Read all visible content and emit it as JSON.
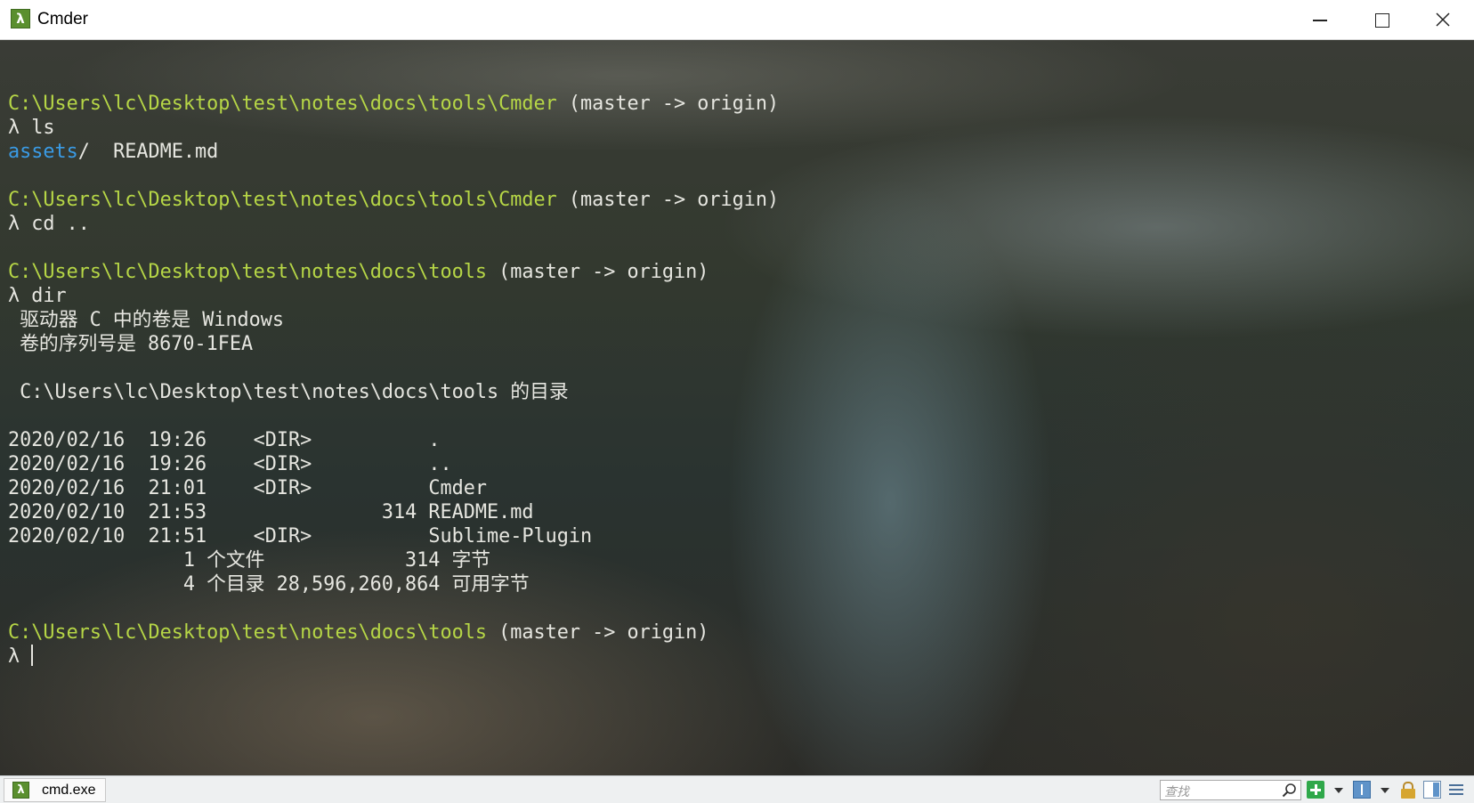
{
  "window": {
    "title": "Cmder",
    "icon_glyph": "λ"
  },
  "terminal": {
    "colors": {
      "path": "#b6d646",
      "text": "#e6e6e0",
      "dir": "#3a9be6"
    },
    "lines": [
      {
        "kind": "blank"
      },
      {
        "kind": "prompt",
        "path": "C:\\Users\\lc\\Desktop\\test\\notes\\docs\\tools\\Cmder",
        "branch": " (master -> origin)"
      },
      {
        "kind": "cmd",
        "text": "λ ls"
      },
      {
        "kind": "ls",
        "dir": "assets",
        "rest": "/  README.md"
      },
      {
        "kind": "blank"
      },
      {
        "kind": "prompt",
        "path": "C:\\Users\\lc\\Desktop\\test\\notes\\docs\\tools\\Cmder",
        "branch": " (master -> origin)"
      },
      {
        "kind": "cmd",
        "text": "λ cd .."
      },
      {
        "kind": "blank"
      },
      {
        "kind": "prompt",
        "path": "C:\\Users\\lc\\Desktop\\test\\notes\\docs\\tools",
        "branch": " (master -> origin)"
      },
      {
        "kind": "cmd",
        "text": "λ dir"
      },
      {
        "kind": "out",
        "text": " 驱动器 C 中的卷是 Windows"
      },
      {
        "kind": "out",
        "text": " 卷的序列号是 8670-1FEA"
      },
      {
        "kind": "blank"
      },
      {
        "kind": "out",
        "text": " C:\\Users\\lc\\Desktop\\test\\notes\\docs\\tools 的目录"
      },
      {
        "kind": "blank"
      },
      {
        "kind": "out",
        "text": "2020/02/16  19:26    <DIR>          ."
      },
      {
        "kind": "out",
        "text": "2020/02/16  19:26    <DIR>          .."
      },
      {
        "kind": "out",
        "text": "2020/02/16  21:01    <DIR>          Cmder"
      },
      {
        "kind": "out",
        "text": "2020/02/10  21:53               314 README.md"
      },
      {
        "kind": "out",
        "text": "2020/02/10  21:51    <DIR>          Sublime-Plugin"
      },
      {
        "kind": "out",
        "text": "               1 个文件            314 字节"
      },
      {
        "kind": "out",
        "text": "               4 个目录 28,596,260,864 可用字节"
      },
      {
        "kind": "blank"
      },
      {
        "kind": "prompt",
        "path": "C:\\Users\\lc\\Desktop\\test\\notes\\docs\\tools",
        "branch": " (master -> origin)"
      },
      {
        "kind": "input",
        "text": "λ "
      }
    ]
  },
  "statusbar": {
    "tab_label": "cmd.exe",
    "tab_icon_glyph": "λ",
    "search_placeholder": "查找",
    "icons": [
      "search-icon",
      "new-console-plus-icon",
      "split-icon",
      "lock-icon",
      "panel-icon",
      "menu-icon"
    ]
  }
}
